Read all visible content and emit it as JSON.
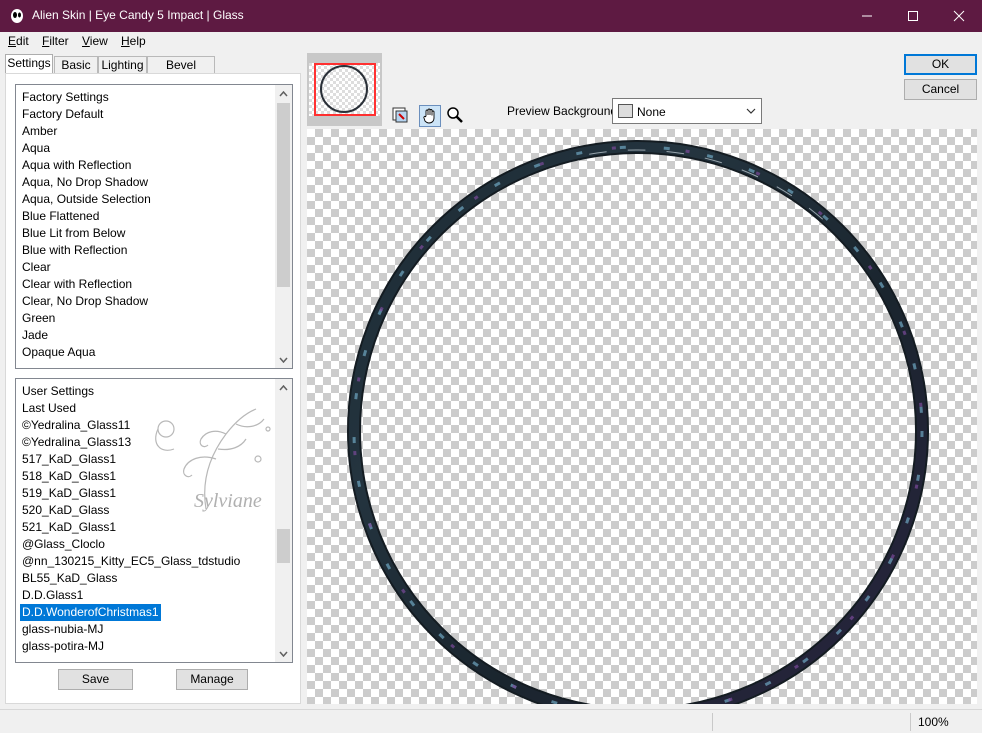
{
  "window": {
    "title": "Alien Skin | Eye Candy 5 Impact | Glass",
    "accent": "#5e1a42"
  },
  "menu": [
    {
      "label": "Edit",
      "key": "E",
      "rest": "dit"
    },
    {
      "label": "Filter",
      "key": "F",
      "rest": "ilter"
    },
    {
      "label": "View",
      "key": "V",
      "rest": "iew"
    },
    {
      "label": "Help",
      "key": "H",
      "rest": "elp"
    }
  ],
  "tabs": [
    "Settings",
    "Basic",
    "Lighting",
    "Bevel Profile"
  ],
  "factory": {
    "header": "Factory Settings",
    "items": [
      "Factory Default",
      "Amber",
      "Aqua",
      "Aqua with Reflection",
      "Aqua, No Drop Shadow",
      "Aqua, Outside Selection",
      "Blue Flattened",
      "Blue Lit from Below",
      "Blue with Reflection",
      "Clear",
      "Clear with Reflection",
      "Clear, No Drop Shadow",
      "Green",
      "Jade",
      "Opaque Aqua"
    ]
  },
  "user": {
    "header": "User Settings",
    "items": [
      "Last Used",
      "©Yedralina_Glass11",
      "©Yedralina_Glass13",
      "517_KaD_Glass1",
      "518_KaD_Glass1",
      "519_KaD_Glass1",
      "520_KaD_Glass",
      "521_KaD_Glass1",
      "@Glass_Cloclo",
      "@nn_130215_Kitty_EC5_Glass_tdstudio",
      "BL55_KaD_Glass",
      "D.D.Glass1",
      "D.D.WonderofChristmas1",
      "glass-nubia-MJ",
      "glass-potira-MJ"
    ],
    "selected": "D.D.WonderofChristmas1"
  },
  "watermark_text": "Sylviane",
  "buttons": {
    "save": "Save",
    "manage": "Manage",
    "ok": "OK",
    "cancel": "Cancel"
  },
  "preview_background": {
    "label": "Preview Background:",
    "value": "None"
  },
  "status": {
    "zoom": "100%"
  },
  "icons": {
    "app": "alien-head-icon",
    "minimize": "minimize-icon",
    "maximize": "maximize-icon",
    "close": "close-icon"
  }
}
